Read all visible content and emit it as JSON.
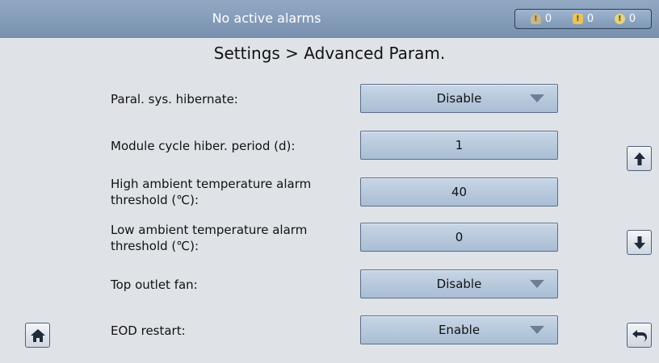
{
  "header": {
    "status_text": "No active alarms",
    "alarm_counts": {
      "minor": {
        "icon": "thermometer-alarm-icon",
        "count": "0"
      },
      "major": {
        "icon": "square-alarm-icon",
        "count": "0"
      },
      "critical": {
        "icon": "circle-alarm-icon",
        "count": "0"
      }
    }
  },
  "page_title": "Settings > Advanced Param.",
  "params": [
    {
      "label": "Paral. sys. hibernate:",
      "value": "Disable",
      "type": "dropdown"
    },
    {
      "label": "Module cycle hiber. period (d):",
      "value": "1",
      "type": "input"
    },
    {
      "label": "High ambient temperature alarm threshold (℃):",
      "value": "40",
      "type": "input"
    },
    {
      "label": "Low ambient temperature alarm threshold (℃):",
      "value": "0",
      "type": "input"
    },
    {
      "label": "Top outlet fan:",
      "value": "Disable",
      "type": "dropdown"
    },
    {
      "label": "EOD restart:",
      "value": "Enable",
      "type": "dropdown"
    }
  ],
  "nav": {
    "scroll_up_icon": "arrow-up-icon",
    "scroll_down_icon": "arrow-down-icon",
    "home_icon": "home-icon",
    "back_icon": "back-arrow-icon"
  },
  "colors": {
    "header_bg": "#8aa1bd",
    "field_bg": "#b8c9dc",
    "page_bg": "#dfe3e8"
  }
}
